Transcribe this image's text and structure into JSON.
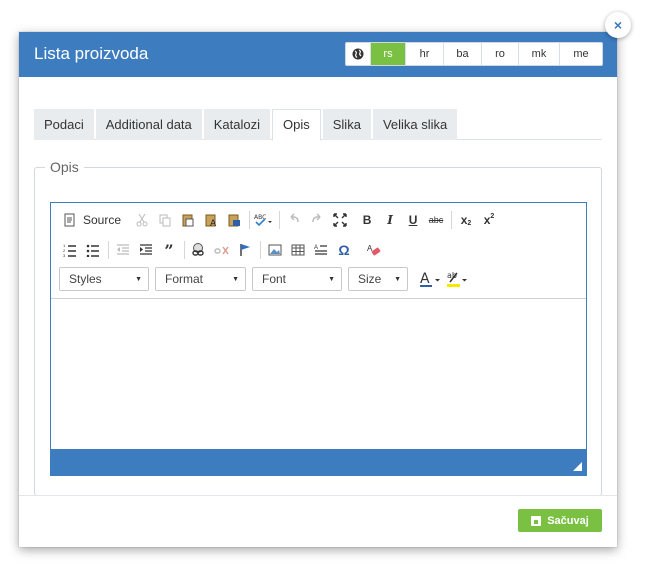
{
  "modal": {
    "title": "Lista proizvoda",
    "close_label": "×",
    "save_label": "Sačuvaj"
  },
  "languages": [
    {
      "code": "rs",
      "active": true
    },
    {
      "code": "hr",
      "active": false
    },
    {
      "code": "ba",
      "active": false
    },
    {
      "code": "ro",
      "active": false
    },
    {
      "code": "mk",
      "active": false
    },
    {
      "code": "me",
      "active": false
    }
  ],
  "tabs": [
    "Podaci",
    "Additional data",
    "Katalozi",
    "Opis",
    "Slika",
    "Velika slika"
  ],
  "active_tab": "Opis",
  "section": {
    "legend": "Opis"
  },
  "editor": {
    "source_label": "Source",
    "combos": [
      "Styles",
      "Format",
      "Font",
      "Size"
    ],
    "content": ""
  },
  "colors": {
    "header_blue": "#3c7cbf",
    "accent_green": "#7ac143"
  }
}
